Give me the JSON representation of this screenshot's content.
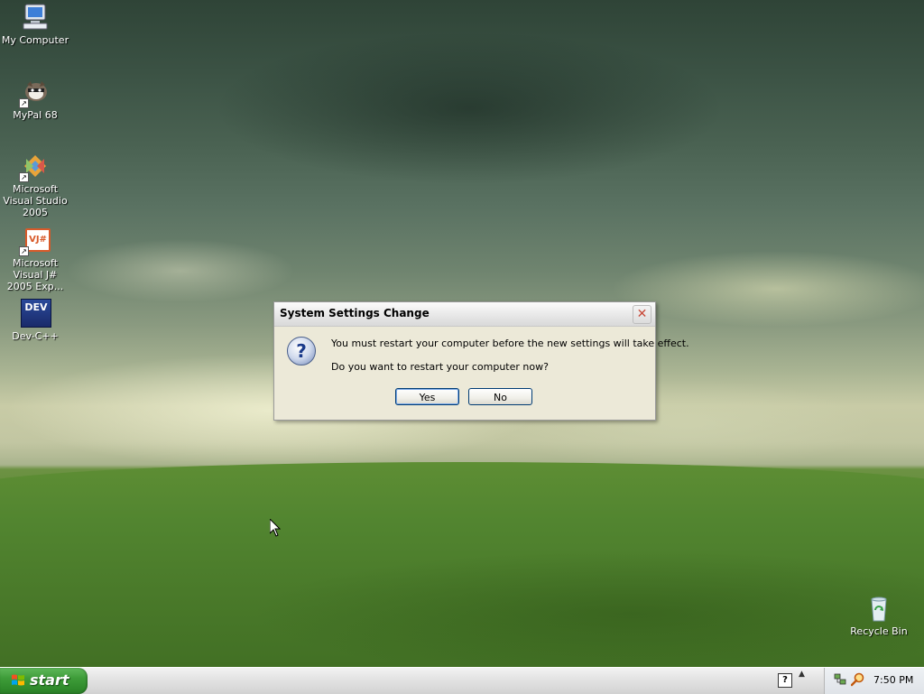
{
  "desktop": {
    "icons": [
      {
        "label": "My Computer",
        "icon": "my-computer-icon"
      },
      {
        "label": "MyPal 68",
        "icon": "mypal-icon"
      },
      {
        "label": "Microsoft Visual Studio 2005",
        "icon": "visual-studio-icon"
      },
      {
        "label": "Microsoft Visual J# 2005 Exp...",
        "icon": "visual-jsharp-icon",
        "badge": "VJ#"
      },
      {
        "label": "Dev-C++",
        "icon": "devcpp-icon",
        "badge": "DEV"
      },
      {
        "label": "Recycle Bin",
        "icon": "recycle-bin-icon"
      }
    ]
  },
  "dialog": {
    "title": "System Settings Change",
    "close_glyph": "✕",
    "icon": "question-icon",
    "icon_glyph": "?",
    "message": "You must restart your computer before the new settings will take effect.",
    "question": "Do you want to restart your computer now?",
    "yes_label": "Yes",
    "no_label": "No"
  },
  "taskbar": {
    "start_label": "start",
    "help_glyph": "?",
    "toggle_glyph": "▲",
    "clock": "7:50 PM"
  },
  "colors": {
    "dialog_bg": "#ece9d8",
    "start_green": "#3e9c39",
    "button_border": "#003c74"
  }
}
